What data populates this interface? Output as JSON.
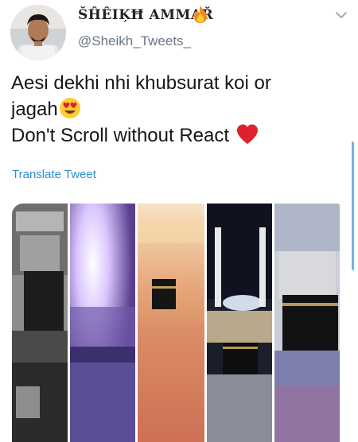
{
  "user": {
    "display_name": "ŠĤÊIĶĦ ΑΜΜΑŘ",
    "handle": "@Sheikh_Tweets_"
  },
  "tweet": {
    "line1": "Aesi dekhi nhi khubsurat koi or",
    "line2": "jagah",
    "line3": "Don't Scroll without React",
    "translate_label": "Translate Tweet"
  },
  "icons": {
    "fire": "fire-emoji-icon",
    "heart_eyes": "heart-eyes-emoji-icon",
    "heart": "red-heart-emoji-icon",
    "chevron": "chevron-down-icon"
  },
  "colors": {
    "text": "#14171a",
    "handle": "#657786",
    "link": "#2f8fd0",
    "heart": "#e0202e"
  }
}
